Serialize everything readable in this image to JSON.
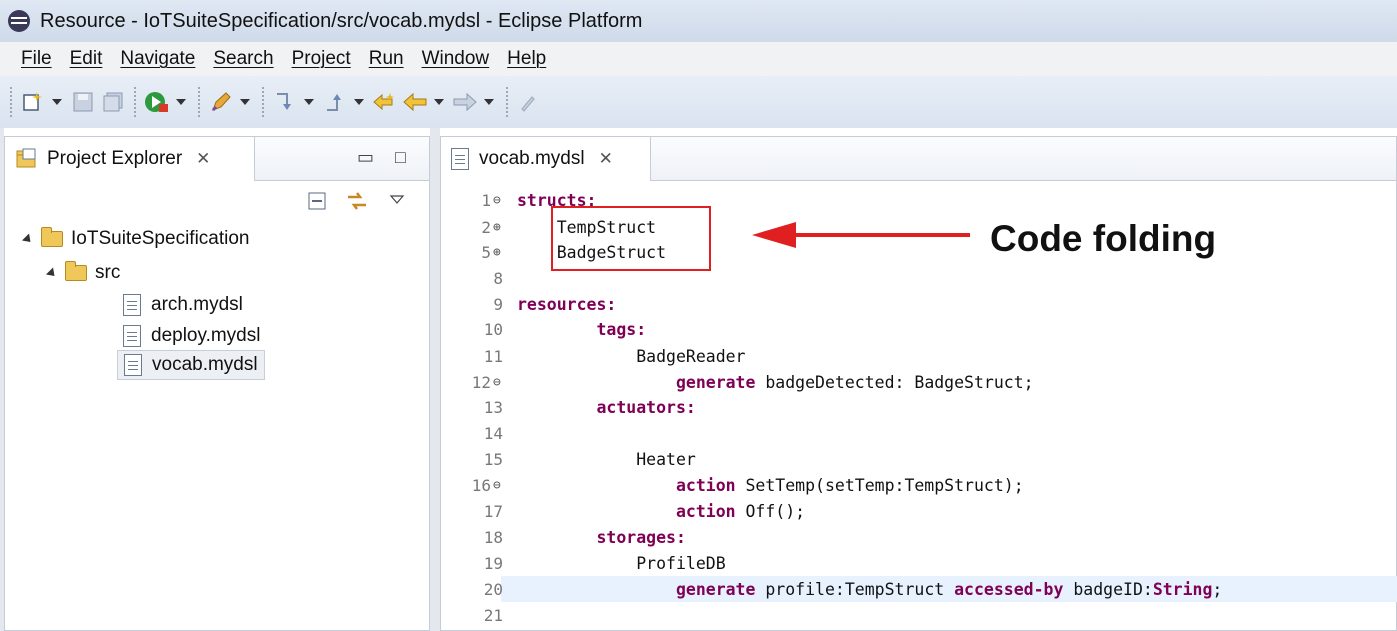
{
  "window": {
    "title": "Resource - IoTSuiteSpecification/src/vocab.mydsl - Eclipse Platform"
  },
  "menu": [
    "File",
    "Edit",
    "Navigate",
    "Search",
    "Project",
    "Run",
    "Window",
    "Help"
  ],
  "explorer": {
    "tab_label": "Project Explorer",
    "tab_close": "✕",
    "project": "IoTSuiteSpecification",
    "folder": "src",
    "files": [
      "arch.mydsl",
      "deploy.mydsl",
      "vocab.mydsl"
    ],
    "selected_file": "vocab.mydsl"
  },
  "editor": {
    "tab_label": "vocab.mydsl",
    "tab_close": "✕",
    "lines": [
      {
        "num": "1",
        "fold": "⊖",
        "kw": "structs:",
        "rest": "",
        "indent": ""
      },
      {
        "num": "2",
        "fold": "⊕",
        "kw": "",
        "rest": "TempStruct",
        "indent": "    "
      },
      {
        "num": "5",
        "fold": "⊕",
        "kw": "",
        "rest": "BadgeStruct",
        "indent": "    "
      },
      {
        "num": "8",
        "fold": "",
        "kw": "",
        "rest": "",
        "indent": ""
      },
      {
        "num": "9",
        "fold": "",
        "kw": "resources:",
        "rest": "",
        "indent": ""
      },
      {
        "num": "10",
        "fold": "",
        "kw": "tags:",
        "rest": "",
        "indent": "        "
      },
      {
        "num": "11",
        "fold": "",
        "kw": "",
        "rest": "BadgeReader",
        "indent": "            "
      },
      {
        "num": "12",
        "fold": "⊖",
        "kw": "generate",
        "rest": " badgeDetected: BadgeStruct;",
        "indent": "                "
      },
      {
        "num": "13",
        "fold": "",
        "kw": "actuators:",
        "rest": "",
        "indent": "        "
      },
      {
        "num": "14",
        "fold": "",
        "kw": "",
        "rest": "",
        "indent": ""
      },
      {
        "num": "15",
        "fold": "",
        "kw": "",
        "rest": "Heater",
        "indent": "            "
      },
      {
        "num": "16",
        "fold": "⊖",
        "kw": "action",
        "rest": " SetTemp(setTemp:TempStruct);",
        "indent": "                "
      },
      {
        "num": "17",
        "fold": "",
        "kw": "action",
        "rest": " Off();",
        "indent": "                "
      },
      {
        "num": "18",
        "fold": "",
        "kw": "storages:",
        "rest": "",
        "indent": "        "
      },
      {
        "num": "19",
        "fold": "",
        "kw": "",
        "rest": "ProfileDB",
        "indent": "            "
      },
      {
        "num": "20",
        "fold": "",
        "kw": "generate",
        "rest": " profile:TempStruct ",
        "kw2": "accessed-by",
        "rest2": " badgeID:",
        "kw3": "String",
        "rest3": ";",
        "indent": "                "
      },
      {
        "num": "21",
        "fold": "",
        "kw": "",
        "rest": "",
        "indent": ""
      }
    ]
  },
  "annotation": {
    "label": "Code folding",
    "color": "#e02020"
  }
}
